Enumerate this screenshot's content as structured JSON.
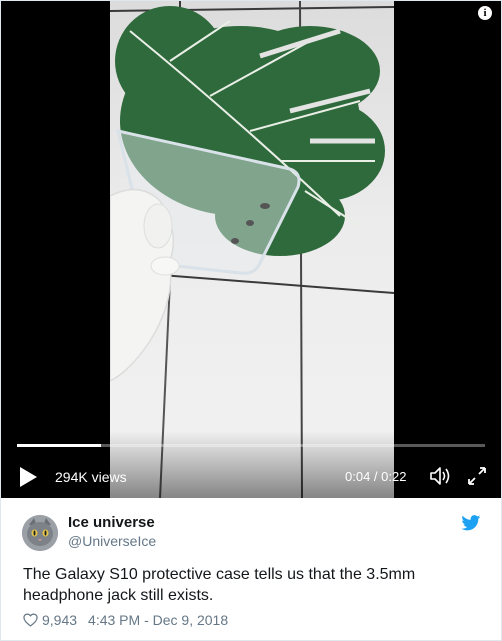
{
  "video": {
    "views_label": "294K views",
    "time_label": "0:04 / 0:22",
    "progress_fraction": 0.18,
    "info_glyph": "i",
    "icons": [
      "play-icon",
      "volume-icon",
      "fullscreen-icon",
      "info-icon"
    ]
  },
  "tweet": {
    "author_name": "Ice universe",
    "author_handle": "@UniverseIce",
    "text": "The Galaxy S10 protective case tells us that the 3.5mm headphone jack still exists.",
    "like_count": "9,943",
    "timestamp": "4:43 PM - Dec 9, 2018",
    "brand_icon": "twitter-bird-icon",
    "colors": {
      "brand_blue": "#1da1f2",
      "secondary_text": "#657786",
      "primary_text": "#14171a"
    }
  }
}
